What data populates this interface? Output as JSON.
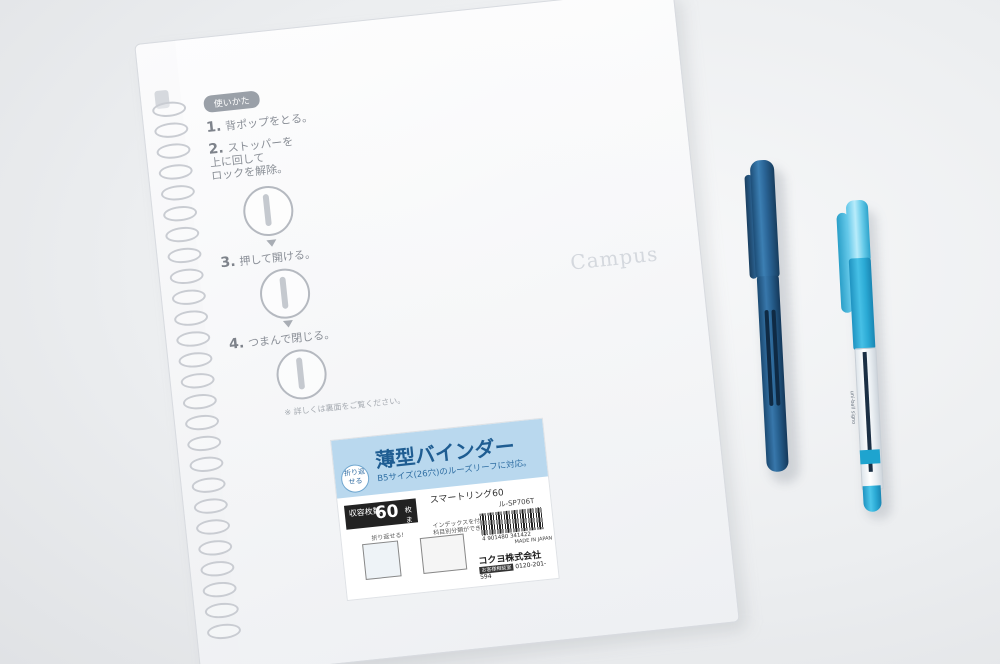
{
  "scene": {
    "subject": "binder-notebook-with-two-pens"
  },
  "binder": {
    "how_to_title": "使いかた",
    "steps": [
      {
        "number": "1.",
        "text": "背ポップをとる。"
      },
      {
        "number": "2.",
        "text": "ストッパーを\n上に回して\nロックを解除。"
      },
      {
        "number": "3.",
        "text": "押して開ける。"
      },
      {
        "number": "4.",
        "text": "つまんで閉じる。"
      }
    ],
    "footnote": "※ 詳しくは裏面をご覧ください。",
    "brand_watermark": "Campus"
  },
  "label": {
    "fold_badge": "折り返せる",
    "title": "薄型バインダー",
    "subtitle": "B5サイズ(26穴)のルーズリーフに対応。",
    "capacity_label": "収容枚数",
    "capacity_value": "60",
    "capacity_unit": "枚まで",
    "product_name": "スマートリング60",
    "product_code": "ル-SP706T",
    "fold_note": "折り返せる!",
    "index_note": "インデックスを付けると\n科目別分類ができる!",
    "barcode_number": "4 901480 341422",
    "made_in": "MADE IN JAPAN",
    "maker": "コクヨ株式会社",
    "tel_badge": "お客様相談室",
    "tel": "0120-201-594"
  },
  "pens": {
    "fountain_pen_color": "#2a6496",
    "gel_pen_color": "#2aa9d4",
    "gel_pen_brand": "uni-ball signo"
  }
}
